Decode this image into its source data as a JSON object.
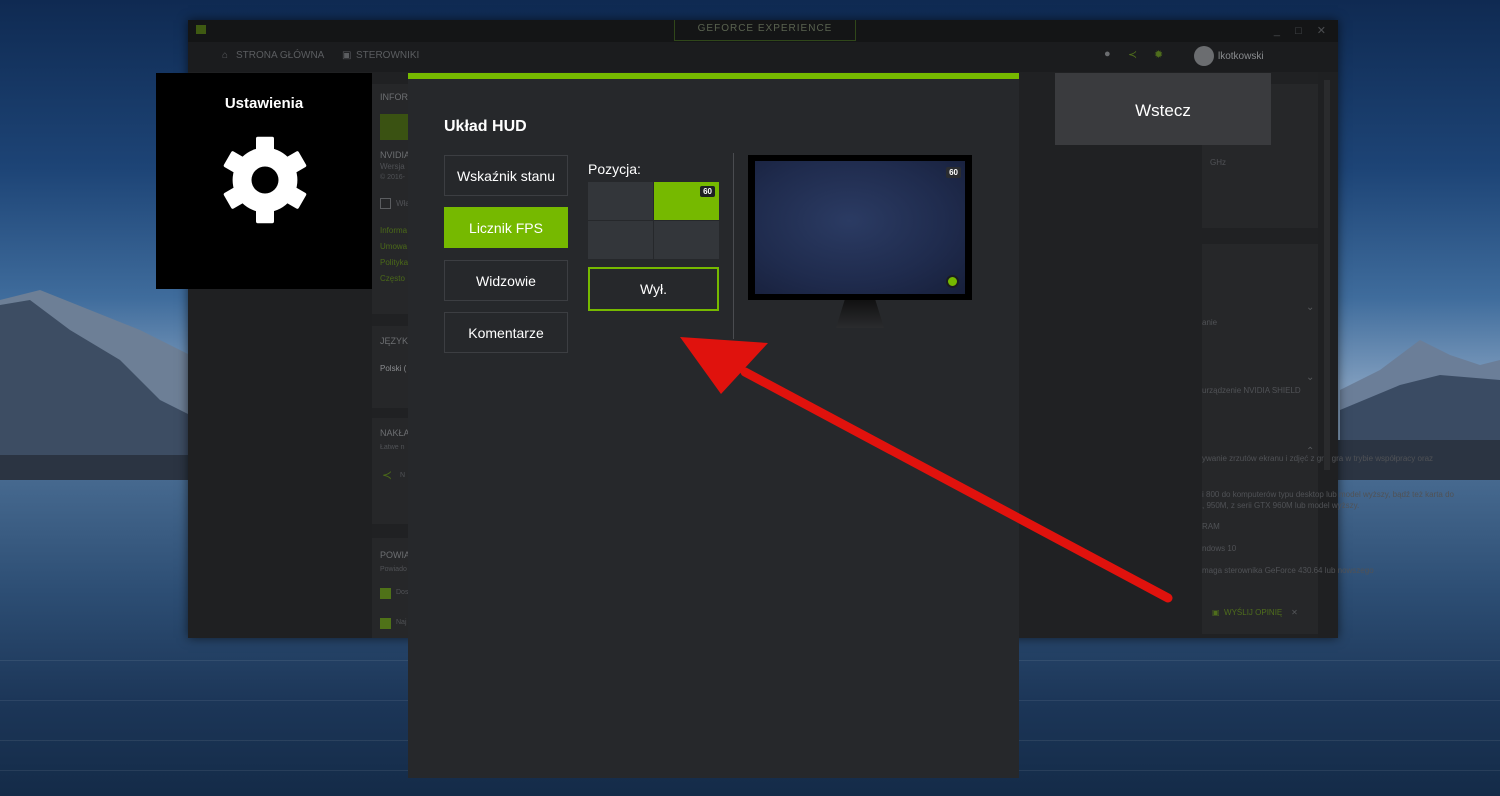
{
  "app": {
    "title": "GEFORCE EXPERIENCE",
    "window_controls": "_ □ ✕",
    "accent_color": "#76b900"
  },
  "nav": {
    "home": "STRONA GŁÓWNA",
    "drivers": "STEROWNIKI",
    "username": "lkotkowski",
    "icons": [
      "bell-icon",
      "share-icon",
      "gear-icon"
    ]
  },
  "background": {
    "cards": {
      "info": {
        "title": "INFOR",
        "product": "NVIDIA",
        "version": "Wersja",
        "copyright": "© 2016-",
        "checkbox": "Włą",
        "links": [
          "Informa",
          "Umowa",
          "Polityka",
          "Często"
        ]
      },
      "language": {
        "title": "JĘZYK",
        "value": "Polski ("
      },
      "overlay": {
        "title": "NAKŁA",
        "desc": "Łatwe n",
        "share": "N"
      },
      "notifications": {
        "title": "POWIA",
        "desc": "Powiado",
        "items": [
          "Dos",
          "Naj"
        ]
      }
    },
    "right_text": {
      "ghz": "GHz",
      "l1": "anie",
      "l2": "urządzenie NVIDIA SHIELD",
      "l3": "ywanie zrzutów ekranu i zdjęć z gry, gra w trybie współpracy oraz",
      "l4": "i 800 do komputerów typu desktop lub model wyższy, bądź też karta do",
      "l5": ", 950M, z serii GTX 960M lub model wyższy.",
      "l6": "RAM",
      "l7": "ndows 10",
      "l8": "maga sterownika GeForce 430.64 lub nowszego"
    },
    "feedback": "WYŚLIJ OPINIĘ"
  },
  "settings_tile": {
    "title": "Ustawienia"
  },
  "back_button": {
    "label": "Wstecz"
  },
  "hud": {
    "title": "Układ HUD",
    "menu": [
      {
        "label": "Wskaźnik stanu",
        "active": false
      },
      {
        "label": "Licznik FPS",
        "active": true
      },
      {
        "label": "Widzowie",
        "active": false
      },
      {
        "label": "Komentarze",
        "active": false
      }
    ],
    "position_label": "Pozycja:",
    "position_selected": "top-right",
    "fps_badge": "60",
    "off_label": "Wył.",
    "preview_fps": "60"
  }
}
